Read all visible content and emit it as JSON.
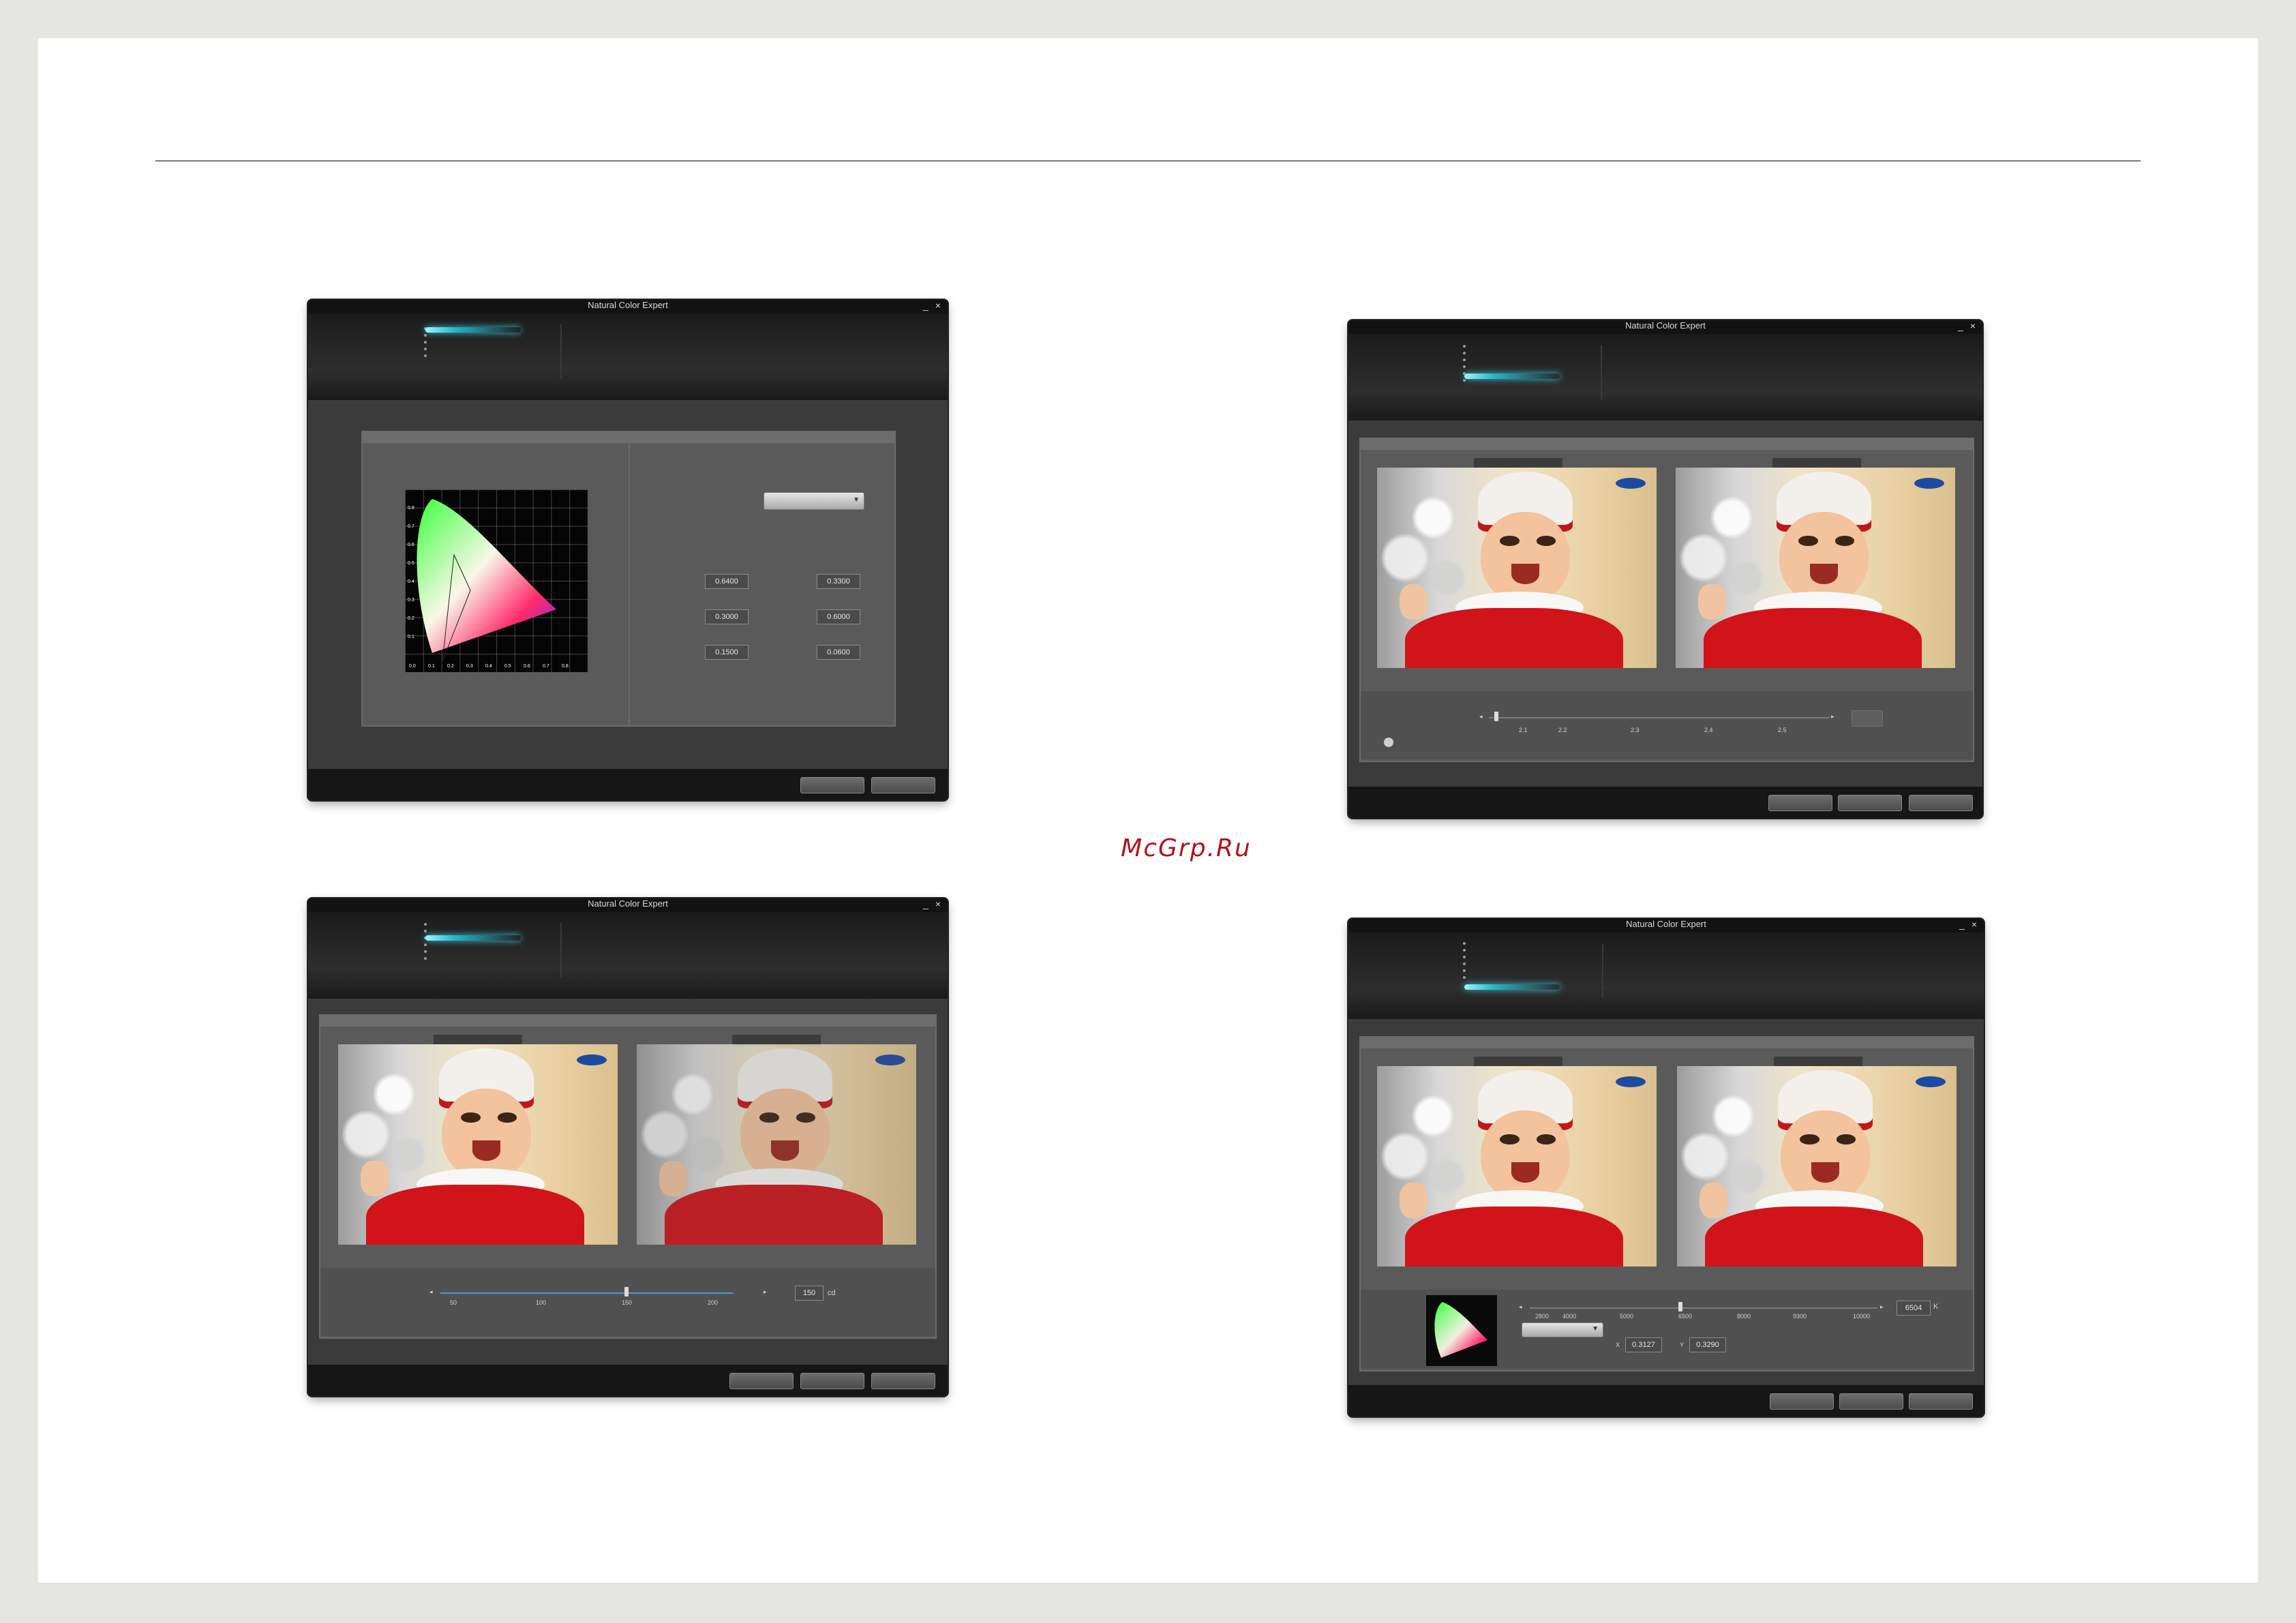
{
  "watermark": "McGrp.Ru",
  "window_title": "Natural Color Expert",
  "window_controls": {
    "minimize": "_",
    "close": "×"
  },
  "gamut_window": {
    "cie_axis_y": [
      "0.8",
      "0.7",
      "0.6",
      "0.5",
      "0.4",
      "0.3",
      "0.2",
      "0.1"
    ],
    "cie_axis_x": [
      "0.0",
      "0.1",
      "0.2",
      "0.3",
      "0.4",
      "0.5",
      "0.6",
      "0.7",
      "0.8"
    ],
    "values": [
      [
        "0.6400",
        "0.3300"
      ],
      [
        "0.3000",
        "0.6000"
      ],
      [
        "0.1500",
        "0.0600"
      ]
    ]
  },
  "gamma_window": {
    "ticks": [
      "2.1",
      "2.2",
      "2.3",
      "2.4",
      "2.5"
    ]
  },
  "luminance_window": {
    "ticks": [
      "50",
      "100",
      "150",
      "200"
    ],
    "value": "150",
    "unit": "cd"
  },
  "white_window": {
    "ticks": [
      "2800",
      "4000",
      "5000",
      "6500",
      "8000",
      "9300",
      "10000"
    ],
    "temperature": "6504",
    "temperature_unit": "K",
    "x_label": "X",
    "x_value": "0.3127",
    "y_label": "Y",
    "y_value": "0.3290"
  },
  "colors": {
    "page": "#ffffff",
    "background": "#e5e5e2",
    "watermark": "#b0141c",
    "accent": "#2ab6c9"
  }
}
